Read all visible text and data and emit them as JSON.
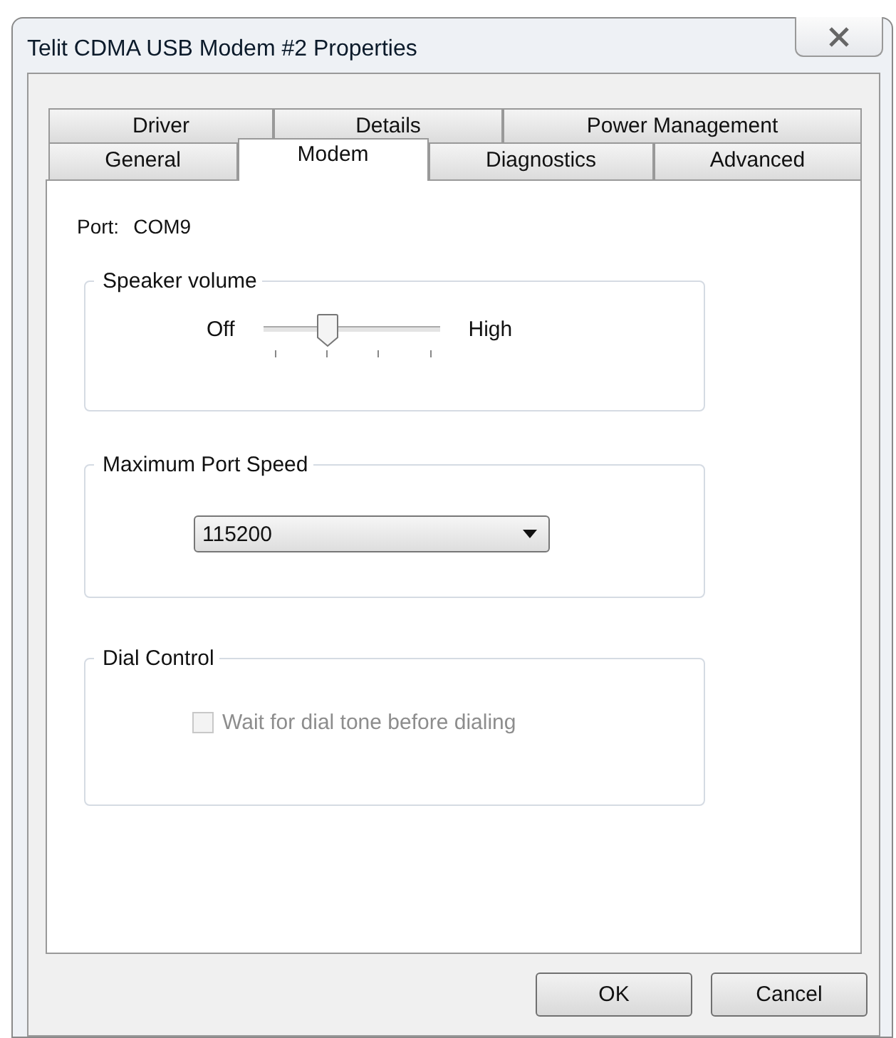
{
  "window": {
    "title": "Telit CDMA USB Modem #2 Properties"
  },
  "tab_rows": [
    [
      {
        "label": "Driver",
        "selected": false
      },
      {
        "label": "Details",
        "selected": false
      },
      {
        "label": "Power Management",
        "selected": false
      }
    ],
    [
      {
        "label": "General",
        "selected": false
      },
      {
        "label": "Modem",
        "selected": true
      },
      {
        "label": "Diagnostics",
        "selected": false
      },
      {
        "label": "Advanced",
        "selected": false
      }
    ]
  ],
  "port": {
    "label": "Port:",
    "value": "COM9"
  },
  "speaker_volume": {
    "title": "Speaker volume",
    "min_label": "Off",
    "max_label": "High",
    "level": 0.33
  },
  "max_port_speed": {
    "title": "Maximum Port Speed",
    "value": "115200"
  },
  "dial_control": {
    "title": "Dial Control",
    "checkbox": {
      "label": "Wait for dial tone before dialing",
      "checked": false,
      "disabled": true
    }
  },
  "buttons": [
    "OK",
    "Cancel"
  ]
}
